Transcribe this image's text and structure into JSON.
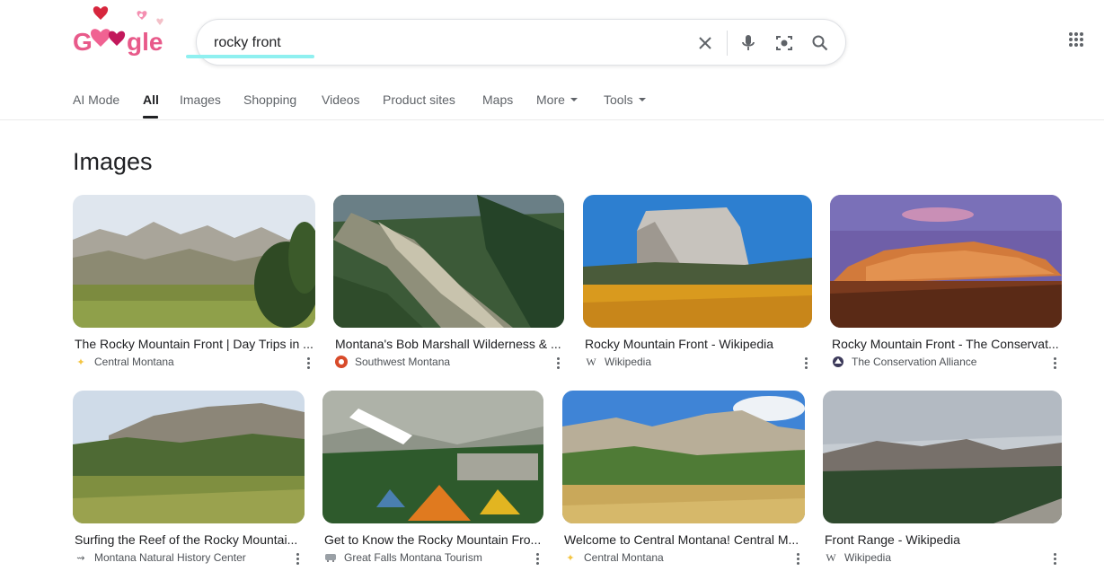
{
  "logo": {
    "text": "Google"
  },
  "search": {
    "query": "rocky front",
    "placeholder": ""
  },
  "tabs": [
    {
      "label": "AI Mode"
    },
    {
      "label": "All"
    },
    {
      "label": "Images"
    },
    {
      "label": "Shopping"
    },
    {
      "label": "Videos"
    },
    {
      "label": "Product sites"
    },
    {
      "label": "Maps"
    },
    {
      "label": "More"
    },
    {
      "label": "Tools"
    }
  ],
  "section": {
    "title": "Images"
  },
  "results": [
    {
      "title": "The Rocky Mountain Front | Day Trips in ...",
      "source": "Central Montana",
      "favicon": "sparkle-icon"
    },
    {
      "title": "Montana's Bob Marshall Wilderness & ...",
      "source": "Southwest Montana",
      "favicon": "swirl-icon"
    },
    {
      "title": "Rocky Mountain Front - Wikipedia",
      "source": "Wikipedia",
      "favicon": "wikipedia-icon"
    },
    {
      "title": "Rocky Mountain Front - The Conservat...",
      "source": "The Conservation Alliance",
      "favicon": "conservation-icon"
    },
    {
      "title": "Surfing the Reef of the Rocky Mountai...",
      "source": "Montana Natural History Center",
      "favicon": "bird-icon"
    },
    {
      "title": "Get to Know the Rocky Mountain Fro...",
      "source": "Great Falls Montana Tourism",
      "favicon": "bus-icon"
    },
    {
      "title": "Welcome to Central Montana! Central M...",
      "source": "Central Montana",
      "favicon": "sparkle-icon"
    },
    {
      "title": "Front Range - Wikipedia",
      "source": "Wikipedia",
      "favicon": "wikipedia-icon"
    }
  ],
  "colors": {
    "accent": "#1a73e8",
    "underline": "#8ff0f0",
    "text": "#202124",
    "muted": "#5f6368"
  }
}
